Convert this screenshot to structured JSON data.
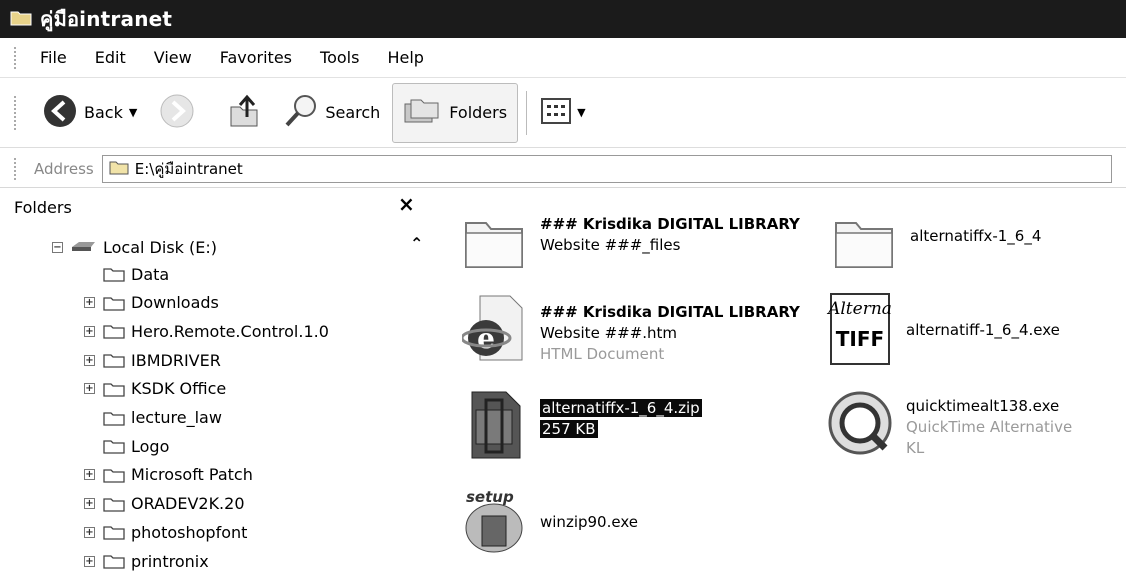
{
  "window": {
    "title": "คู่มือintranet"
  },
  "menu": [
    {
      "label": "File"
    },
    {
      "label": "Edit"
    },
    {
      "label": "View"
    },
    {
      "label": "Favorites"
    },
    {
      "label": "Tools"
    },
    {
      "label": "Help"
    }
  ],
  "toolbar": {
    "back_label": "Back",
    "search_label": "Search",
    "folders_label": "Folders"
  },
  "address": {
    "label": "Address",
    "value": "E:\\คู่มือintranet"
  },
  "folders_pane": {
    "header": "Folders",
    "close_glyph": "×",
    "root": "Local Disk (E:)",
    "items": [
      {
        "label": "Data",
        "expandable": false
      },
      {
        "label": "Downloads",
        "expandable": true
      },
      {
        "label": "Hero.Remote.Control.1.0",
        "expandable": true
      },
      {
        "label": "IBMDRIVER",
        "expandable": true
      },
      {
        "label": "KSDK Office",
        "expandable": true
      },
      {
        "label": "lecture_law",
        "expandable": false
      },
      {
        "label": "Logo",
        "expandable": false
      },
      {
        "label": "Microsoft Patch",
        "expandable": true
      },
      {
        "label": "ORADEV2K.20",
        "expandable": true
      },
      {
        "label": "photoshopfont",
        "expandable": true
      },
      {
        "label": "printronix",
        "expandable": true
      }
    ]
  },
  "files": [
    {
      "line1": "### Krisdika DIGITAL LIBRARY",
      "line2": "Website ###_files",
      "line3": "",
      "icon": "folder-icon"
    },
    {
      "line1": "alternatiffx-1_6_4",
      "line2": "",
      "line3": "",
      "icon": "folder-icon"
    },
    {
      "line1": "### Krisdika DIGITAL LIBRARY",
      "line2": "Website ###.htm",
      "line3": "HTML Document",
      "icon": "ie-html-icon"
    },
    {
      "line1": "alternatiff-1_6_4.exe",
      "line2": "",
      "line3": "",
      "icon": "alternatiff-icon"
    },
    {
      "line1": "alternatiffx-1_6_4.zip",
      "line2": "257 KB",
      "line3": "",
      "icon": "zip-icon",
      "selected": true
    },
    {
      "line1": "quicktimealt138.exe",
      "line2": "QuickTime Alternative",
      "line3": "KL",
      "icon": "quicktime-icon"
    },
    {
      "line1": "winzip90.exe",
      "line2": "",
      "line3": "",
      "icon": "winzip-setup-icon"
    }
  ],
  "icon_text": {
    "alternatiff_top": "Alterna",
    "alternatiff_bottom": "TIFF",
    "setup": "setup"
  },
  "colors": {
    "titlebar": "#1b1b1b",
    "selection": "#0a0a0a",
    "folder": "#f5e6a8"
  }
}
